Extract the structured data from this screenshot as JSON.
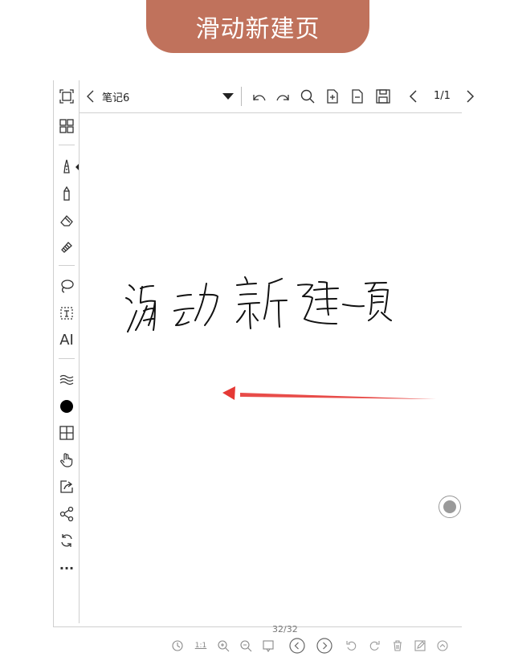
{
  "banner": {
    "title": "滑动新建页"
  },
  "toolbar": {
    "back_label": "笔记6",
    "page_indicator": "1/1",
    "icons": [
      "undo-icon",
      "redo-icon",
      "search-icon",
      "add-page-icon",
      "remove-page-icon",
      "save-icon",
      "prev-page-icon",
      "next-page-icon"
    ]
  },
  "sidebar": {
    "icons": [
      "fullscreen-icon",
      "grid-icon",
      "pen-icon",
      "marker-icon",
      "eraser-icon",
      "highlighter-icon",
      "lasso-icon",
      "text-box-icon",
      "ai-icon",
      "wave-icon",
      "color-dot-icon",
      "table-icon",
      "hand-icon",
      "export-icon",
      "share-icon",
      "sync-icon",
      "more-icon"
    ],
    "ai_label": "AI",
    "more_label": "···"
  },
  "canvas": {
    "handwriting": "滑动新建一页",
    "arrow_color": "#e53935"
  },
  "bottom_bar": {
    "page_count": "32/32",
    "ratio_label": "1:1"
  },
  "colors": {
    "banner": "#c0725c",
    "border": "#cfcfcf"
  }
}
